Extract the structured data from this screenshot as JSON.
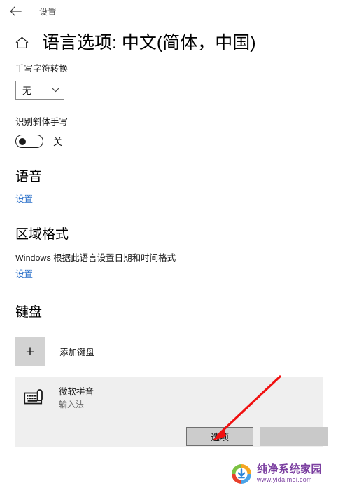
{
  "titlebar": {
    "back_icon": "back-arrow-icon",
    "label": "设置"
  },
  "header": {
    "home_icon": "home-icon",
    "title": "语言选项: 中文(简体，中国)"
  },
  "handwriting": {
    "label": "手写字符转换",
    "dropdown_value": "无",
    "dropdown_icon": "chevron-down-icon"
  },
  "cursive": {
    "label": "识别斜体手写",
    "toggle_state": "关",
    "toggle_on": false
  },
  "speech": {
    "heading": "语音",
    "link": "设置"
  },
  "region": {
    "heading": "区域格式",
    "description": "Windows 根据此语言设置日期和时间格式",
    "link": "设置"
  },
  "keyboard": {
    "heading": "键盘",
    "add_icon": "plus-icon",
    "add_label": "添加键盘",
    "ime": {
      "icon": "keyboard-hand-icon",
      "name": "微软拼音",
      "subtitle": "输入法",
      "options_button": "选项",
      "secondary_button": ""
    }
  },
  "annotation": {
    "arrow_color": "#f01010",
    "arrow_name": "red-pointer-arrow"
  },
  "watermark": {
    "logo_icon": "download-circle-logo",
    "title": "纯净系统家园",
    "url": "www.yidaimei.com",
    "brand_color": "#7b3fa0"
  }
}
